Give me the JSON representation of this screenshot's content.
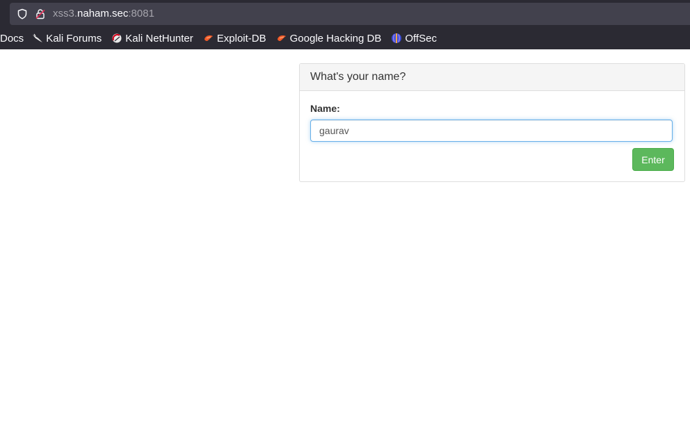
{
  "browser": {
    "url_prefix": "xss3.",
    "url_host": "naham.sec",
    "url_port": ":8081",
    "bookmarks": [
      {
        "label": "Docs",
        "icon": "none"
      },
      {
        "label": "Kali Forums",
        "icon": "kali-dragon-icon"
      },
      {
        "label": "Kali NetHunter",
        "icon": "nethunter-icon"
      },
      {
        "label": "Exploit-DB",
        "icon": "exploit-db-icon"
      },
      {
        "label": "Google Hacking DB",
        "icon": "ghdb-icon"
      },
      {
        "label": "OffSec",
        "icon": "offsec-icon"
      }
    ]
  },
  "panel": {
    "heading": "What's your name?",
    "name_label": "Name:",
    "name_value": "gaurav",
    "submit_label": "Enter"
  },
  "colors": {
    "chrome_bg": "#2b2a33",
    "urlbar_bg": "#42414d",
    "button_green": "#5cb85c",
    "input_focus": "#66afe9"
  }
}
